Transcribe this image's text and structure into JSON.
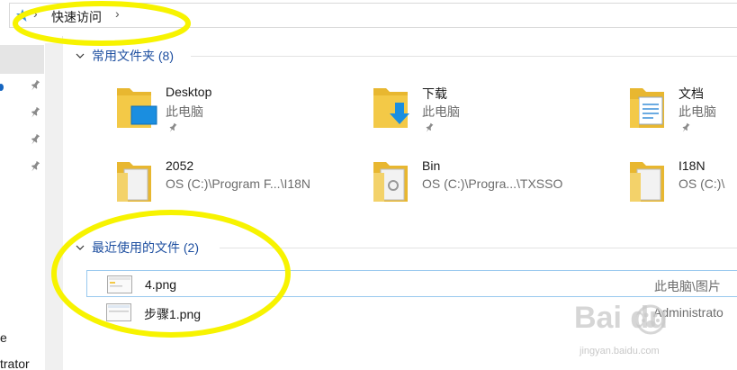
{
  "address_bar": {
    "icon": "quick-access-star-icon",
    "separator": "›",
    "path": [
      "快速访问"
    ]
  },
  "nav_pane": {
    "fragments": [
      "e",
      "trator"
    ],
    "pin_icon": "pin-icon"
  },
  "frequent_folders": {
    "title": "常用文件夹 (8)",
    "items": [
      {
        "name": "Desktop",
        "location": "此电脑",
        "icon": "desktop-folder-icon",
        "pinned": true
      },
      {
        "name": "下载",
        "location": "此电脑",
        "icon": "downloads-folder-icon",
        "pinned": true
      },
      {
        "name": "文档",
        "location": "此电脑",
        "icon": "documents-folder-icon",
        "pinned": true
      },
      {
        "name": "2052",
        "location": "OS (C:)\\Program F...\\I18N",
        "icon": "folder-icon",
        "pinned": false
      },
      {
        "name": "Bin",
        "location": "OS (C:)\\Progra...\\TXSSO",
        "icon": "folder-icon",
        "pinned": false
      },
      {
        "name": "I18N",
        "location": "OS (C:)\\",
        "icon": "folder-icon",
        "pinned": false
      }
    ]
  },
  "recent_files": {
    "title": "最近使用的文件 (2)",
    "items": [
      {
        "name": "4.png",
        "location": "此电脑\\图片",
        "icon": "image-file-icon",
        "selected": true
      },
      {
        "name": "步骤1.png",
        "location": "Administrato",
        "icon": "image-file-icon",
        "selected": false
      }
    ]
  },
  "watermark": {
    "brand": "Bai du",
    "url": "jingyan.baidu.com",
    "icon": "baidu-paw-logo"
  },
  "colors": {
    "group_title": "#1e4fa0",
    "folder_yellow": "#f3c947",
    "highlight_yellow": "#f7f300",
    "selection_border": "#99c9ef"
  }
}
